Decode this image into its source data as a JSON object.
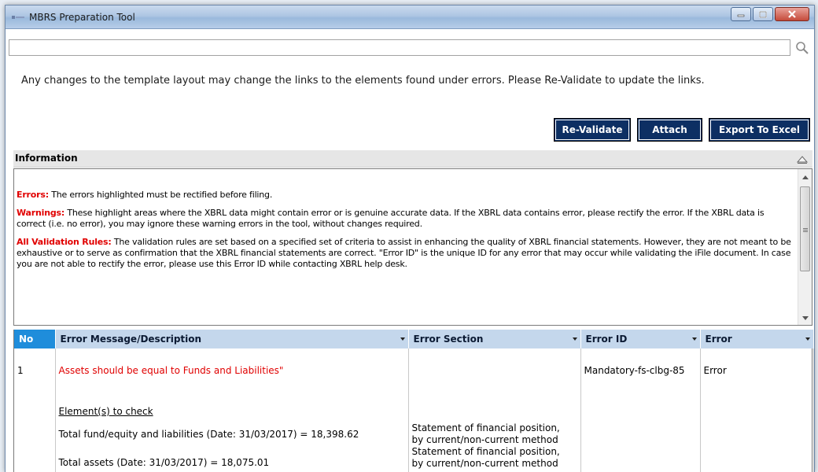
{
  "window": {
    "title": "MBRS Preparation Tool"
  },
  "search": {
    "value": ""
  },
  "notice_text": "Any changes to the template layout may change the links to the elements found under errors. Please Re-Validate to update the links.",
  "actions": {
    "revalidate": "Re-Validate",
    "attach": "Attach",
    "export": "Export To Excel"
  },
  "information": {
    "header": "Information",
    "errors_label": "Errors:",
    "errors_text": " The errors highlighted must be rectified before filing.",
    "warnings_label": "Warnings:",
    "warnings_text": " These highlight areas where the XBRL data might contain error or is genuine accurate data. If the XBRL data contains error, please rectify the error. If the XBRL data is correct (i.e. no error), you may ignore these warning errors in the tool, without changes required.",
    "rules_label": "All Validation Rules:",
    "rules_text": " The validation rules are set based on a specified set of criteria to assist in enhancing the quality of XBRL financial statements. However, they are not meant to be exhaustive or to serve as confirmation that the XBRL financial statements are correct. \"Error ID\" is the unique ID for any error that may occur while validating the iFile document. In case you are not able to rectify the error, please use this Error ID while contacting XBRL help desk."
  },
  "grid": {
    "columns": {
      "no": "No",
      "message": "Error Message/Description",
      "section": "Error Section",
      "error_id": "Error ID",
      "error": "Error"
    },
    "rows": [
      {
        "no": "1",
        "message": "Assets should be equal to Funds and Liabilities\"",
        "elements_label": "Element(s) to check",
        "element_1": "Total fund/equity and liabilities (Date: 31/03/2017) = 18,398.62",
        "element_2": "Total assets (Date: 31/03/2017) = 18,075.01",
        "section_1a": "Statement of financial position,",
        "section_1b": "by current/non-current method",
        "section_2a": "Statement of financial position,",
        "section_2b": "by current/non-current method",
        "error_id": "Mandatory-fs-clbg-85",
        "error": "Error"
      }
    ]
  }
}
